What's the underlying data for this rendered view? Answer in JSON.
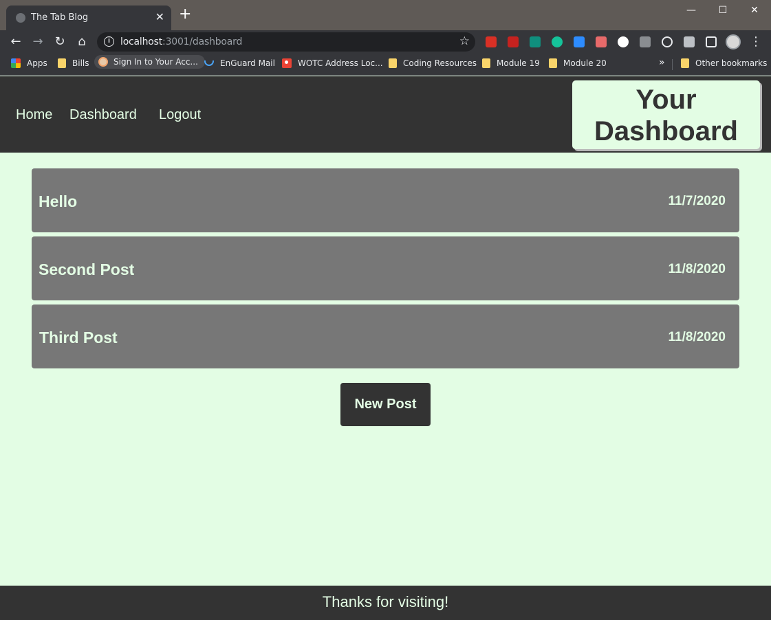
{
  "browser": {
    "tab_title": "The Tab Blog",
    "url_host": "localhost",
    "url_rest": ":3001/dashboard",
    "window_controls": [
      "minimize-icon",
      "maximize-icon",
      "close-icon"
    ],
    "bookmarks": [
      {
        "label": "Apps",
        "icon": "apps-grid-icon"
      },
      {
        "label": "Bills",
        "icon": "folder-icon"
      },
      {
        "label": "Sign In to Your Acc...",
        "icon": "site-icon"
      },
      {
        "label": "EnGuard Mail",
        "icon": "mail-icon"
      },
      {
        "label": "WOTC Address Loc...",
        "icon": "map-pin-icon"
      },
      {
        "label": "Coding Resources",
        "icon": "folder-icon"
      },
      {
        "label": "Module 19",
        "icon": "folder-icon"
      },
      {
        "label": "Module 20",
        "icon": "folder-icon"
      }
    ],
    "overflow_label": "»",
    "other_bookmarks": "Other bookmarks"
  },
  "nav": {
    "home": "Home",
    "dashboard": "Dashboard",
    "logout": "Logout"
  },
  "header": {
    "title_line1": "Your",
    "title_line2": "Dashboard"
  },
  "posts": [
    {
      "title": "Hello",
      "date": "11/7/2020"
    },
    {
      "title": "Second Post",
      "date": "11/8/2020"
    },
    {
      "title": "Third Post",
      "date": "11/8/2020"
    }
  ],
  "actions": {
    "new_post": "New Post"
  },
  "footer": {
    "text": "Thanks for visiting!"
  },
  "colors": {
    "page_bg": "#e3fde4",
    "header_bg": "#333333",
    "post_bg": "#777777",
    "accent_text": "#e3fde4"
  }
}
